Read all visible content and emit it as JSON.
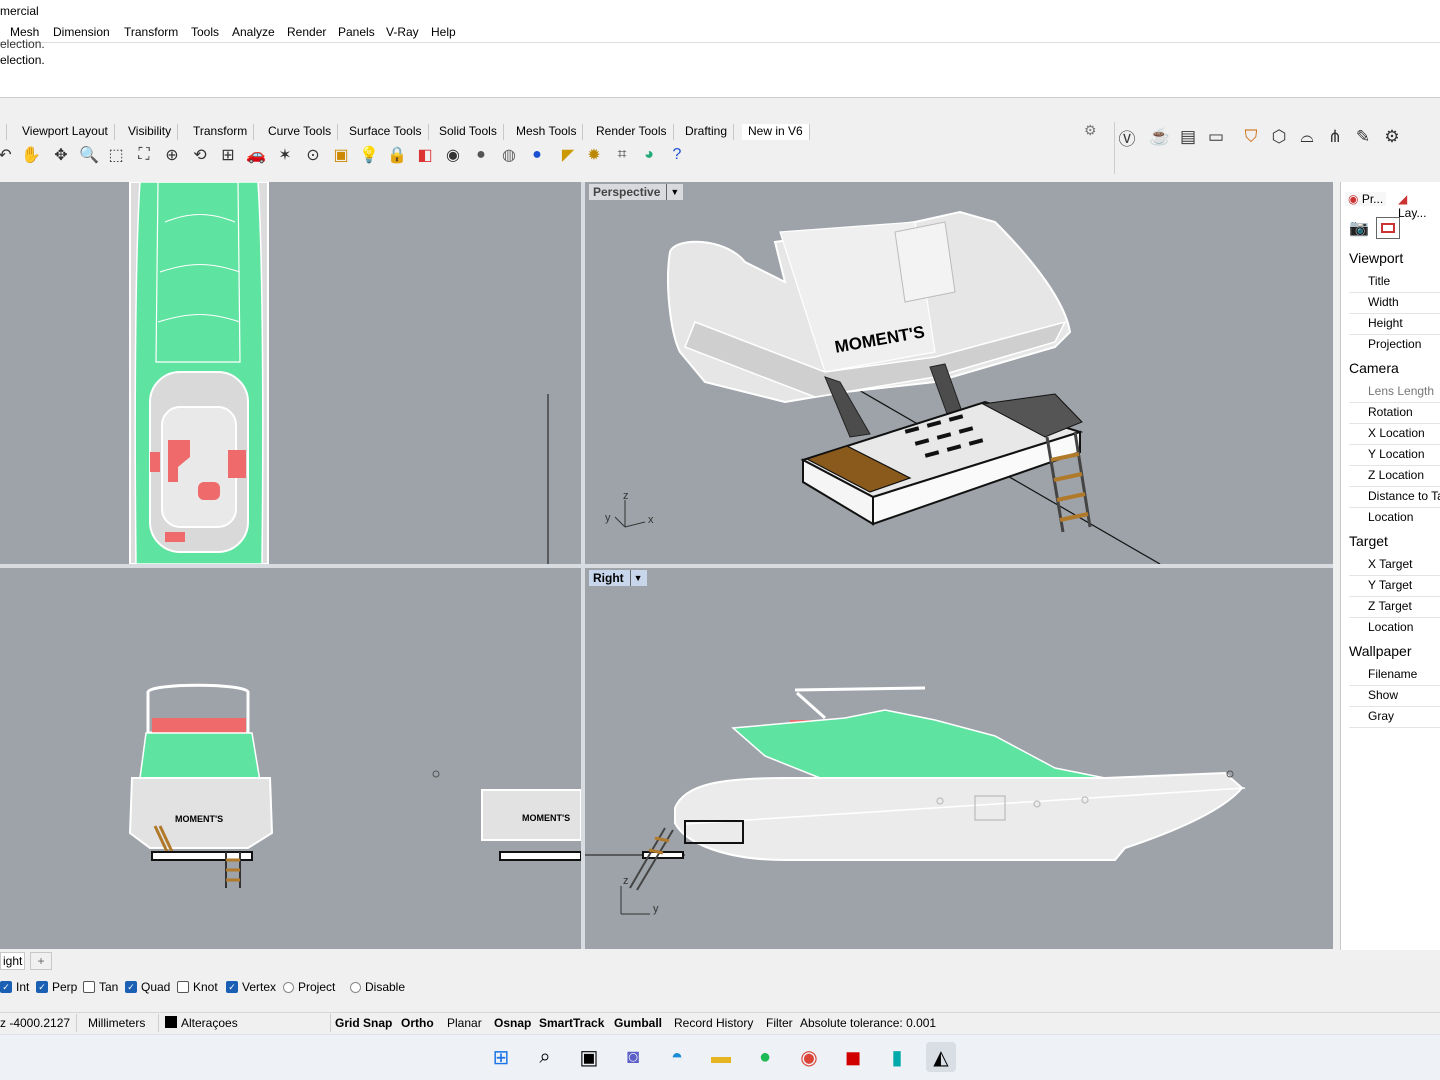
{
  "window": {
    "title_fragment": "mercial"
  },
  "menu": [
    "Mesh",
    "Dimension",
    "Transform",
    "Tools",
    "Analyze",
    "Render",
    "Panels",
    "V-Ray",
    "Help"
  ],
  "command_history": [
    "election.",
    "election."
  ],
  "toolbar_tabs": [
    "Viewport Layout",
    "Visibility",
    "Transform",
    "Curve Tools",
    "Surface Tools",
    "Solid Tools",
    "Mesh Tools",
    "Render Tools",
    "Drafting",
    "New in V6"
  ],
  "toolbar_icons": [
    "rotate-view-icon",
    "pan-hand-icon",
    "move-view-icon",
    "zoom-icon",
    "zoom-window-icon",
    "zoom-extents-icon",
    "zoom-selected-icon",
    "undo-view-icon",
    "four-viewports-icon",
    "car-icon",
    "lights-icon",
    "point-icon",
    "snapshot-icon",
    "light-bulb-icon",
    "lock-icon",
    "display-mode-icon",
    "color-wheel-icon",
    "sphere-icon",
    "render-sphere-icon",
    "material-sphere-icon",
    "dimension-icon",
    "gear-settings-icon",
    "grid-icon",
    "globe-icon",
    "help-icon"
  ],
  "right_toolbar_icons": [
    "vray-icon",
    "teapot-icon",
    "frame-buffer-icon",
    "window-icon",
    "light-tool-icon",
    "cube-icon",
    "dome-light-icon",
    "grass-icon",
    "brush-icon",
    "render-settings-icon"
  ],
  "viewports": {
    "top": {
      "label": ""
    },
    "perspective": {
      "label": "Perspective"
    },
    "front": {
      "label": ""
    },
    "right": {
      "label": "Right"
    }
  },
  "viewport_labels": {
    "brand_text": "MOMENT'S",
    "axis_x": "x",
    "axis_y": "y",
    "axis_z": "z"
  },
  "panel": {
    "tabs": [
      "Pr...",
      "Lay..."
    ],
    "sections": [
      {
        "title": "Viewport",
        "rows": [
          "Title",
          "Width",
          "Height",
          "Projection"
        ]
      },
      {
        "title": "Camera",
        "rows": [
          "Lens Length",
          "Rotation",
          "X Location",
          "Y Location",
          "Z Location",
          "Distance to Ta",
          "Location"
        ]
      },
      {
        "title": "Target",
        "rows": [
          "X Target",
          "Y Target",
          "Z Target",
          "Location"
        ]
      },
      {
        "title": "Wallpaper",
        "rows": [
          "Filename",
          "Show",
          "Gray"
        ]
      }
    ]
  },
  "viewport_tabs": {
    "current": "ight",
    "add": "+"
  },
  "osnaps": [
    {
      "label": "Int",
      "checked": true
    },
    {
      "label": "Perp",
      "checked": true
    },
    {
      "label": "Tan",
      "checked": false
    },
    {
      "label": "Quad",
      "checked": true
    },
    {
      "label": "Knot",
      "checked": false
    },
    {
      "label": "Vertex",
      "checked": true
    },
    {
      "label": "Project",
      "radio": true
    },
    {
      "label": "Disable",
      "radio": true
    }
  ],
  "status": {
    "coord": "z -4000.2127",
    "units": "Millimeters",
    "layer": "Alteraçoes",
    "layer_color": "#000000",
    "toggles": [
      "Grid Snap",
      "Ortho",
      "Planar",
      "Osnap",
      "SmartTrack",
      "Gumball",
      "Record History",
      "Filter"
    ],
    "tolerance": "Absolute tolerance: 0.001"
  },
  "colors": {
    "viewport_bg": "#9ea3a9",
    "selection_green": "#5fe3a1",
    "highlight_red": "#ef6b6b",
    "deck_wood": "#8a5a1c"
  },
  "taskbar_icons": [
    "windows-start-icon",
    "search-icon",
    "task-view-icon",
    "teams-icon",
    "edge-icon",
    "file-explorer-icon",
    "spotify-icon",
    "chrome-icon",
    "acrobat-icon",
    "3ds-max-icon",
    "rhino-icon"
  ]
}
